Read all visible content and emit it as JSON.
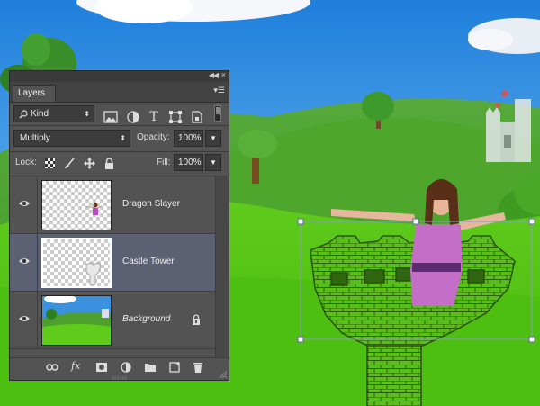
{
  "panel": {
    "tab_label": "Layers",
    "filter": {
      "kind_label": "Kind"
    },
    "blend_mode": "Multiply",
    "opacity_label": "Opacity:",
    "opacity_value": "100%",
    "lock_label": "Lock:",
    "fill_label": "Fill:",
    "fill_value": "100%",
    "fx_label": "fx"
  },
  "layers": [
    {
      "name": "Dragon Slayer",
      "visible": true,
      "selected": false
    },
    {
      "name": "Castle Tower",
      "visible": true,
      "selected": true
    },
    {
      "name": "Background",
      "visible": true,
      "selected": false,
      "locked": true
    }
  ],
  "icons": {
    "collapse": "double-chevron-icon",
    "close": "close-icon",
    "panel_menu": "panel-menu-icon",
    "search": "search-icon",
    "image_filter": "image-filter-icon",
    "adjustment_filter": "adjustment-filter-icon",
    "type_filter": "type-filter-icon",
    "shape_filter": "shape-filter-icon",
    "smart_object_filter": "smart-object-filter-icon",
    "filter_toggle": "filter-toggle-icon",
    "lock_transparent": "lock-transparent-pixels-icon",
    "lock_image": "lock-image-pixels-icon",
    "lock_position": "lock-position-icon",
    "lock_all": "lock-all-icon",
    "eye": "eye-icon",
    "link": "link-layers-icon",
    "mask": "add-mask-icon",
    "adjustment": "new-adjustment-layer-icon",
    "group": "new-group-icon",
    "new_layer": "new-layer-icon",
    "trash": "delete-layer-icon"
  },
  "colors": {
    "panel_bg": "#535353",
    "selected_layer": "#5c6073",
    "sky": "#2b8be0",
    "grass": "#3db515"
  }
}
